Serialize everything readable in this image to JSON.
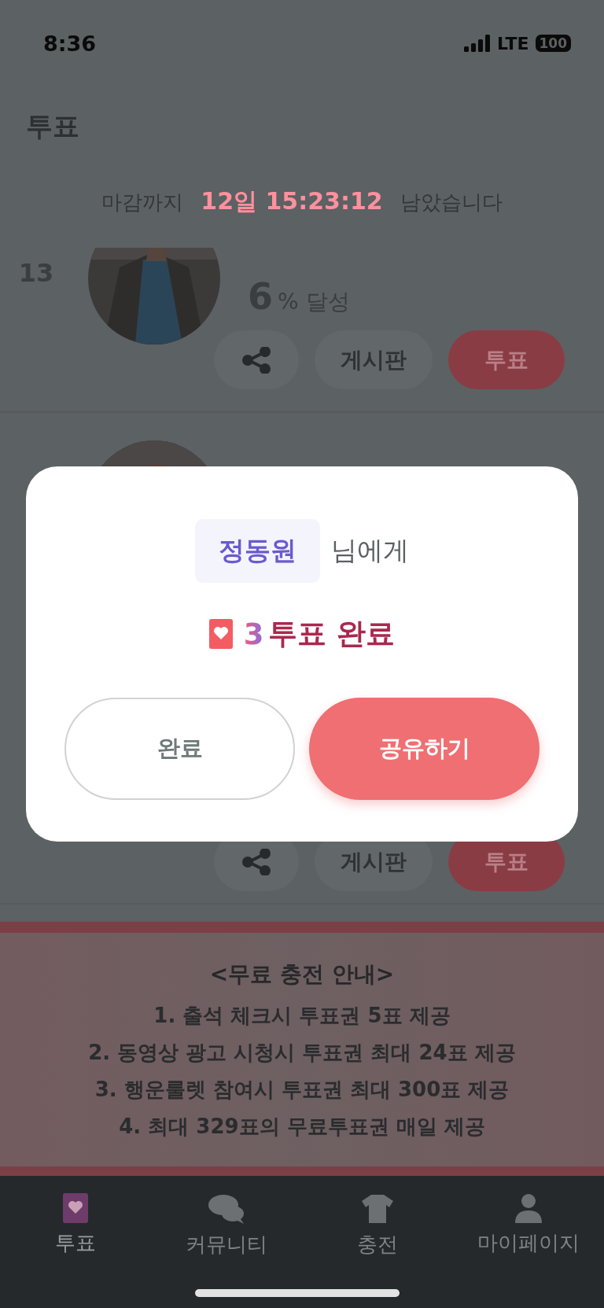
{
  "status_bar": {
    "time": "8:36",
    "network": "LTE",
    "battery": "100"
  },
  "header": {
    "title": "투표",
    "countdown": {
      "prefix": "마감까지",
      "time": "12일 15:23:12",
      "suffix": "남았습니다"
    }
  },
  "candidates": [
    {
      "rank": "13",
      "progress": {
        "value": "6",
        "unit": "% 달성"
      },
      "board": "게시판",
      "vote": "투표"
    },
    {
      "board": "게시판",
      "vote": "투표"
    }
  ],
  "notice": {
    "title": "<무료 충전 안내>",
    "lines": [
      "1. 출석 체크시 투표권 5표 제공",
      "2. 동영상 광고 시청시 투표권 최대 24표 제공",
      "3. 행운룰렛 참여시 투표권 최대 300표 제공",
      "4. 최대 329표의 무료투표권 매일 제공"
    ]
  },
  "tabs": [
    {
      "label": "투표",
      "kind": "vote",
      "selected": true
    },
    {
      "label": "커뮤니티",
      "kind": "community",
      "selected": false
    },
    {
      "label": "충전",
      "kind": "charge",
      "selected": false
    },
    {
      "label": "마이페이지",
      "kind": "mypage",
      "selected": false
    }
  ],
  "dialog": {
    "name": "정동원",
    "suffix": "님에게",
    "count": "3",
    "message": "투표 완료",
    "buttons": [
      {
        "label": "완료",
        "kind": "outline"
      },
      {
        "label": "공유하기",
        "kind": "primary"
      }
    ]
  }
}
